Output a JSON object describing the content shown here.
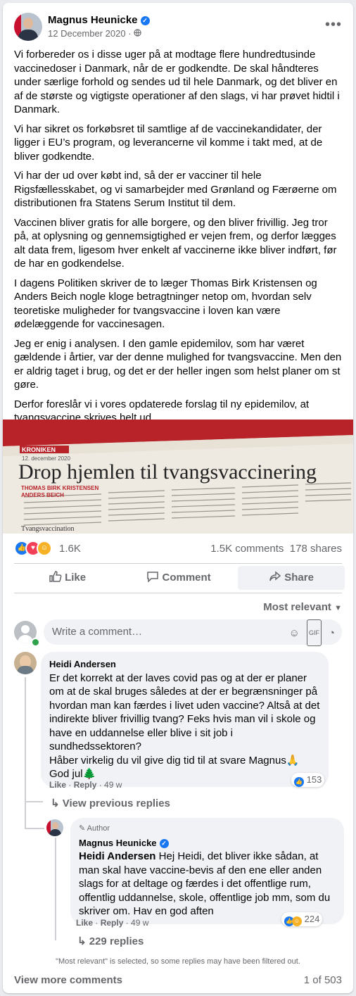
{
  "post": {
    "author": "Magnus Heunicke",
    "date": "12 December 2020",
    "date_separator": "·",
    "privacy_icon": "globe-icon",
    "paragraphs": [
      "Vi forbereder os i disse uger på at modtage flere hundredtusinde vaccinedoser i Danmark, når de er godkendte. De skal håndteres under særlige forhold og sendes ud til hele Danmark, og det bliver en af de største og vigtigste operationer af den slags, vi har prøvet hidtil i Danmark.",
      "Vi har sikret os forkøbsret til samtlige af de vaccinekandidater, der ligger i EU’s program, og leverancerne vil komme i takt med, at de bliver godkendte.",
      "Vi har der ud over købt ind, så der er vacciner til hele Rigsfællesskabet, og vi samarbejder med Grønland og Færøerne om distributionen fra Statens Serum Institut til dem.",
      "Vaccinen bliver gratis for alle borgere, og den bliver frivillig. Jeg tror på, at oplysning og gennemsigtighed er vejen frem, og derfor lægges alt data frem, ligesom hver enkelt af vaccinerne ikke bliver indført, før de har en godkendelse.",
      "I dagens Politiken skriver de to læger Thomas Birk Kristensen og Anders Beich nogle kloge betragtninger netop om, hvordan selv teoretiske muligheder for tvangsvaccine i loven kan være ødelæggende for vaccinesagen.",
      "Jeg er enig i analysen. I den gamle epidemilov, som har været gældende i årtier, var der denne mulighed for tvangsvaccine. Men den er aldrig taget i brug, og det er der heller ingen som helst planer om st gøre.",
      "Derfor foreslår vi i vores opdaterede forslag til ny epidemilov, at tvangsvaccine skrives helt ud."
    ]
  },
  "photo": {
    "kicker": "KRONIKEN",
    "date": "12. december 2020",
    "headline": "Drop hjemlen til tvangsvaccinering",
    "byline_1": "THOMAS BIRK KRISTENSEN",
    "byline_2": "ANDERS BEICH",
    "side_word": "Tvangsvaccination"
  },
  "stats": {
    "reactions": "1.6K",
    "comments": "1.5K comments",
    "shares": "178 shares"
  },
  "actions": {
    "like": "Like",
    "comment": "Comment",
    "share": "Share"
  },
  "sort_label": "Most relevant",
  "write_placeholder": "Write a comment…",
  "comments": [
    {
      "author": "Heidi Andersen",
      "text_lines": [
        "Er det korrekt at der laves covid pas og at der er planer om at de skal bruges således at der er begrænsninger på hvordan man kan færdes i livet uden vaccine? Altså at det indirekte bliver frivillig tvang? Feks hvis man vil i skole og have en uddannelse eller blive i sit job i sundhedssektoren?",
        "Håber virkelig du vil give dig tid til at svare Magnus🙏",
        "God jul🌲"
      ],
      "like": "Like",
      "reply": "Reply",
      "time": "49 w",
      "reaction_count": "153",
      "view_previous": "View previous replies"
    },
    {
      "badge": "Author",
      "author": "Magnus Heunicke",
      "mention": "Heidi Andersen",
      "text": "Hej Heidi, det bliver ikke sådan, at man skal have vaccine-bevis af den ene eller anden slags for at deltage og færdes i det offentlige rum, offentlig uddannelse, skole, offentlige job mm, som du skriver om. Hav en god aften",
      "like": "Like",
      "reply": "Reply",
      "time": "49 w",
      "reaction_count": "224",
      "replies": "229 replies"
    }
  ],
  "filter_note": "\"Most relevant\" is selected, so some replies may have been filtered out.",
  "footer": {
    "view_more": "View more comments",
    "count": "1 of 503"
  },
  "colors": {
    "accent": "#1877f2",
    "secondary_text": "#65676b",
    "like_blue": "#1877f2",
    "love_red": "#f33e58"
  }
}
